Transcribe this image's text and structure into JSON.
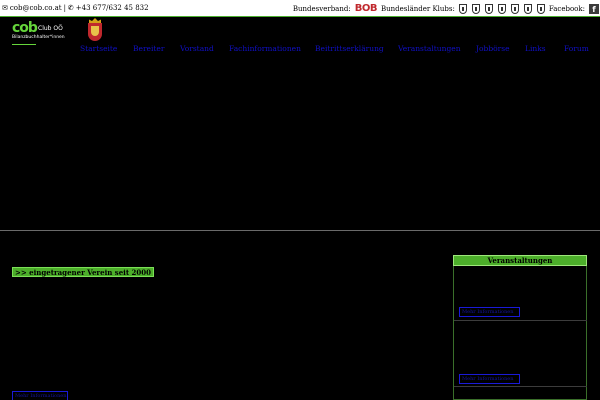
{
  "topbar": {
    "email": "cob@cob.co.at",
    "divider": "|",
    "phone": "+43 677/632 45 832",
    "bundesverband_label": "Bundesverband:",
    "bob_logo": "BOB",
    "bundeslaender_label": "Bundesländer Klubs:",
    "facebook_label": "Facebook:",
    "crest_count": 7
  },
  "logo": {
    "mark": "cob",
    "club": "Club OÖ",
    "sub": "Bilanzbuchhalter*innen"
  },
  "nav": {
    "items": [
      "Startseite",
      "Bereiter",
      "Vorstand",
      "Fachinformationen",
      "Beitrittserklärung",
      "Veranstaltungen",
      "Jobbörse",
      "Links",
      "Forum"
    ]
  },
  "main": {
    "verein_badge": ">> eingetragener Verein seit 2000",
    "bottom_link": "Mehr Informationen"
  },
  "sidebar": {
    "title": "Veranstaltungen",
    "links": [
      "Mehr Informationen",
      "Mehr Informationen"
    ]
  },
  "colors": {
    "accent_green": "#4cae2a",
    "nav_blue": "#1010c8",
    "bob_red": "#c0282d"
  }
}
